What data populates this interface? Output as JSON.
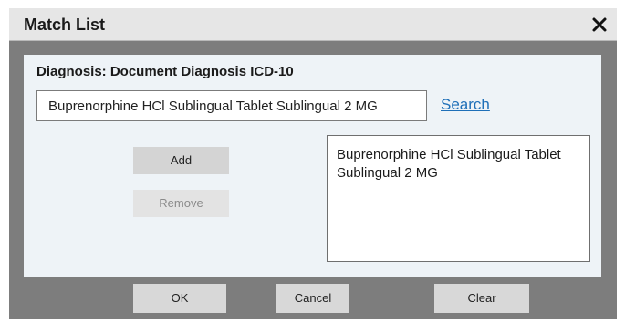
{
  "dialog": {
    "title": "Match List",
    "close_icon": "close-icon"
  },
  "panel": {
    "diagnosis_label": "Diagnosis: Document Diagnosis ICD-10",
    "search_value": "Buprenorphine HCl Sublingual Tablet Sublingual 2 MG",
    "search_link": "Search",
    "add_label": "Add",
    "remove_label": "Remove",
    "match_list": [
      {
        "label": "Buprenorphine HCl Sublingual Tablet Sublingual 2 MG"
      }
    ]
  },
  "footer": {
    "ok_label": "OK",
    "cancel_label": "Cancel",
    "clear_label": "Clear"
  },
  "colors": {
    "dialog_bg": "#7d7d7d",
    "titlebar_bg": "#e6e6e6",
    "panel_bg": "#eef3f7",
    "link": "#1e6fb8"
  }
}
